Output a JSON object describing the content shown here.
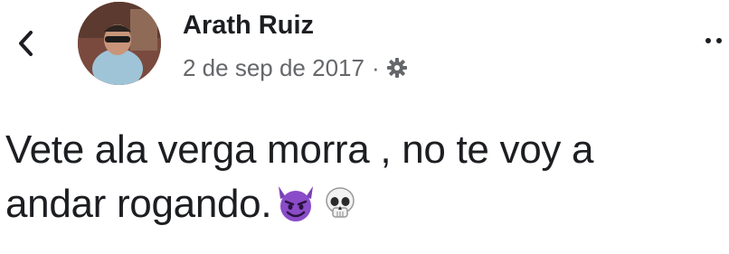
{
  "post": {
    "author_name": "Arath Ruiz",
    "date": "2 de sep de 2017",
    "separator": "·",
    "audience_icon": "gear-icon",
    "text_line1": "Vete ala verga morra , no te voy a",
    "text_line2": "andar rogando.",
    "emojis": [
      "smiling-imp-icon",
      "skull-icon"
    ]
  },
  "nav": {
    "back_icon": "chevron-left-icon",
    "more_icon": "more-options-icon"
  },
  "colors": {
    "text": "#1c1e21",
    "secondary": "#65676b",
    "imp_purple": "#7b3fb4"
  }
}
